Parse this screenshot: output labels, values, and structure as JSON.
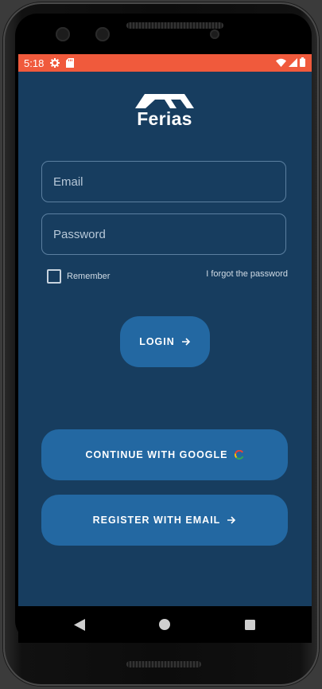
{
  "status_bar": {
    "time": "5:18",
    "icons_left": [
      "gear-icon",
      "sd-card-icon"
    ],
    "icons_right": [
      "wifi-icon",
      "signal-icon",
      "battery-icon"
    ],
    "color": "#f05a3c"
  },
  "brand": {
    "name": "Ferias",
    "logo_icon": "ferias-logo-mark"
  },
  "login_form": {
    "email_placeholder": "Email",
    "password_placeholder": "Password",
    "remember_label": "Remember",
    "forgot_label": "I forgot the password",
    "login_label": "LOGIN"
  },
  "alt_actions": {
    "google_label": "CONTINUE WITH GOOGLE",
    "register_label": "REGISTER WITH EMAIL"
  },
  "nav_bar": {
    "icons": [
      "back-icon",
      "home-icon",
      "recents-icon"
    ]
  },
  "colors": {
    "background": "#173d5f",
    "button": "#2368a2",
    "status_bar": "#f05a3c"
  }
}
